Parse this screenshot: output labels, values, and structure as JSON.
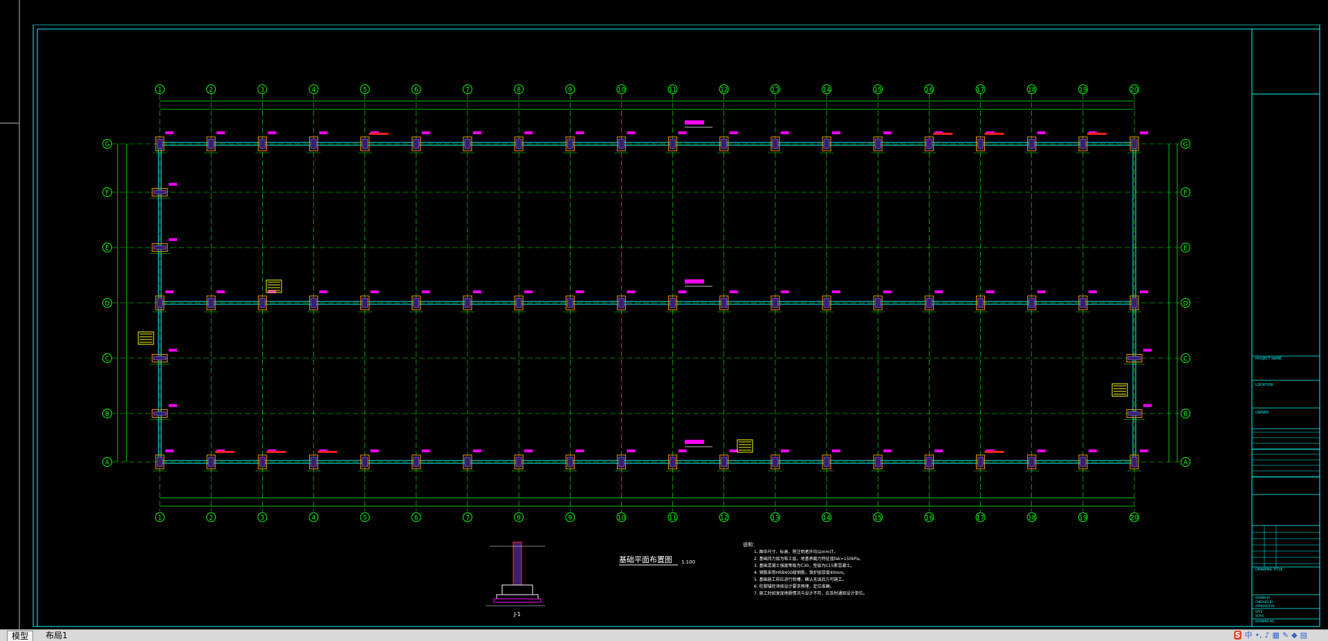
{
  "drawing": {
    "grid_columns": [
      "1",
      "2",
      "3",
      "4",
      "5",
      "6",
      "7",
      "8",
      "9",
      "10",
      "11",
      "12",
      "13",
      "14",
      "15",
      "16",
      "17",
      "18",
      "19",
      "20"
    ],
    "grid_rows": [
      "G",
      "F",
      "E",
      "D",
      "C",
      "B",
      "A"
    ],
    "plan_title": "基础平面布置图",
    "plan_scale": "1:100",
    "section_title": "J-1",
    "notes_title": "说明：",
    "notes": [
      "1. 图中尺寸、标高、除注明者外均以mm计。",
      "2. 基础持力层为粘土层，地基承载力特征值fak=150kPa。",
      "3. 基础混凝土强度等级为C30，垫层为C15素混凝土。",
      "4. 钢筋采用HRB400级钢筋，保护层厚度40mm。",
      "5. 基础施工前应进行验槽，确认无误后方可施工。",
      "6. 柱脚锚栓须按设计要求预埋，定位准确。",
      "7. 施工时如发现地质情况与设计不符，应及时通知设计单位。"
    ]
  },
  "title_block": {
    "project_name_label": "PROJECT NAME",
    "location_label": "LOCATION",
    "owner_label": "OWNER",
    "drawing_title_label": "DRAWING TITLE",
    "drawn_by_label": "DRAWN BY",
    "checked_by_label": "CHECKED BY",
    "approved_by_label": "APPROVED BY",
    "date_label": "DATE",
    "scale_label": "SCALE",
    "drawing_no_label": "DRAWING NO."
  },
  "tabs": {
    "model": "模型",
    "layout1": "布局1"
  },
  "ime": {
    "logo": "S",
    "lang": "中"
  },
  "colors": {
    "grid_line": "#00ff00",
    "column": "#ff9900",
    "beam": "#00ffff",
    "annotation": "#ff00ff",
    "red_text": "#ff2020",
    "yellow_tag": "#ffff00",
    "frame": "#00ffff",
    "dimension": "#ffffff"
  }
}
